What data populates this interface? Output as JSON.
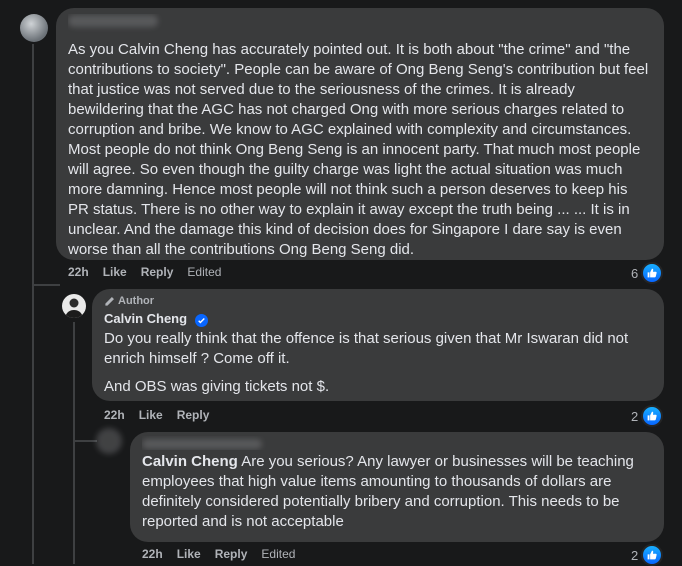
{
  "comments": [
    {
      "author": "John Ong",
      "text": "As you Calvin Cheng has accurately pointed out. It is both about \"the crime\" and \"the contributions to society\". People can be aware of Ong Beng Seng's contribution but feel that justice was not served due to the seriousness of the crimes. It is already bewildering that the AGC has not charged Ong with more serious charges related to corruption and bribe. We know to AGC explained with complexity and circumstances. Most people do not think Ong Beng Seng is an innocent party. That much most people will agree. So even though the guilty charge was light the actual situation was much more damning. Hence most people will not think such a person deserves to keep his PR status. There is no other way to explain it away except the truth being ... ... It is in unclear. And the damage this kind of decision does for Singapore I dare say is even worse than all the contributions Ong Beng Seng did.",
      "time": "22h",
      "like": "Like",
      "reply": "Reply",
      "edited": "Edited",
      "reactions": "6"
    },
    {
      "badge": "Author",
      "author": "Calvin Cheng",
      "paragraph1": "Do you really think that the offence is that serious given that Mr Iswaran did not enrich himself ? Come off it.",
      "paragraph2": "And OBS was giving tickets not $.",
      "time": "22h",
      "like": "Like",
      "reply": "Reply",
      "reactions": "2"
    },
    {
      "mention": "Calvin Cheng",
      "text": " Are you serious? Any lawyer or businesses will be teaching employees that high value items amounting to thousands of dollars are definitely considered potentially bribery and corruption. This needs to be reported and is not acceptable",
      "time": "22h",
      "like": "Like",
      "reply": "Reply",
      "edited": "Edited",
      "reactions": "2"
    }
  ],
  "colors": {
    "background": "#18191a",
    "bubble": "#3a3b3c",
    "like_blue": "#0866ff"
  }
}
